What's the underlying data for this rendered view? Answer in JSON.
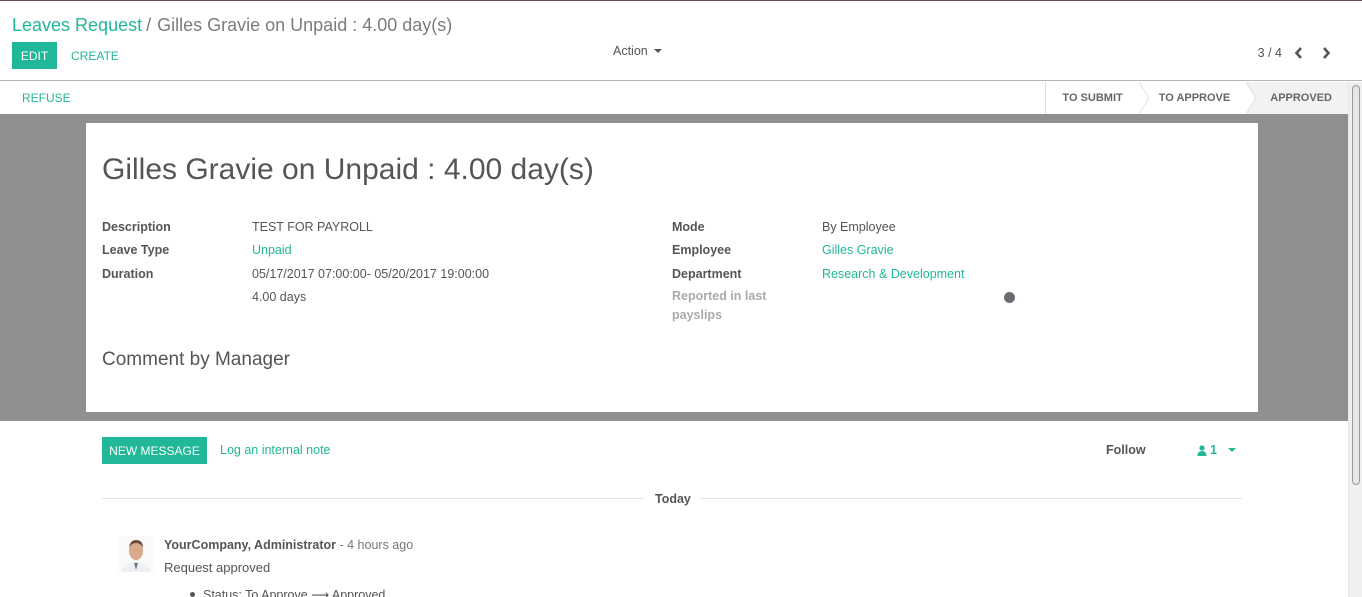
{
  "breadcrumb": {
    "parent": "Leaves Request",
    "separator": "/",
    "current": "Gilles Gravie on Unpaid : 4.00 day(s)"
  },
  "toolbar": {
    "edit_label": "EDIT",
    "create_label": "CREATE",
    "action_label": "Action"
  },
  "pager": {
    "value": "3 / 4",
    "prev_icon": "chevron-left-icon",
    "next_icon": "chevron-right-icon"
  },
  "statusbar": {
    "refuse_label": "REFUSE",
    "steps": [
      {
        "label": "TO SUBMIT",
        "active": false
      },
      {
        "label": "TO APPROVE",
        "active": false
      },
      {
        "label": "APPROVED",
        "active": true
      }
    ]
  },
  "record": {
    "title": "Gilles Gravie on Unpaid : 4.00 day(s)",
    "left_fields": [
      {
        "label": "Description",
        "value": "TEST FOR PAYROLL"
      },
      {
        "label": "Leave Type",
        "value": "Unpaid"
      },
      {
        "label": "Duration",
        "value": "05/17/2017 07:00:00-  05/20/2017 19:00:00",
        "extra": "4.00 days"
      }
    ],
    "right_fields": [
      {
        "label": "Mode",
        "value": "By Employee"
      },
      {
        "label": "Employee",
        "value": "Gilles Gravie"
      },
      {
        "label": "Department",
        "value": "Research & Development"
      },
      {
        "label": "Reported in last payslips",
        "value": ""
      }
    ],
    "comment_section": "Comment by Manager"
  },
  "chatter": {
    "new_message_label": "NEW MESSAGE",
    "log_note_label": "Log an internal note",
    "follow_label": "Follow",
    "followers_count": "1",
    "date_separator": "Today",
    "messages": [
      {
        "author": "YourCompany, Administrator",
        "date": " - 4 hours ago",
        "body": "Request approved",
        "tracking": "Status: To Approve ⟶ Approved"
      }
    ]
  },
  "colors": {
    "brand": "#21b799",
    "sheet_background": "#8f8f8f",
    "text": "#555555"
  }
}
